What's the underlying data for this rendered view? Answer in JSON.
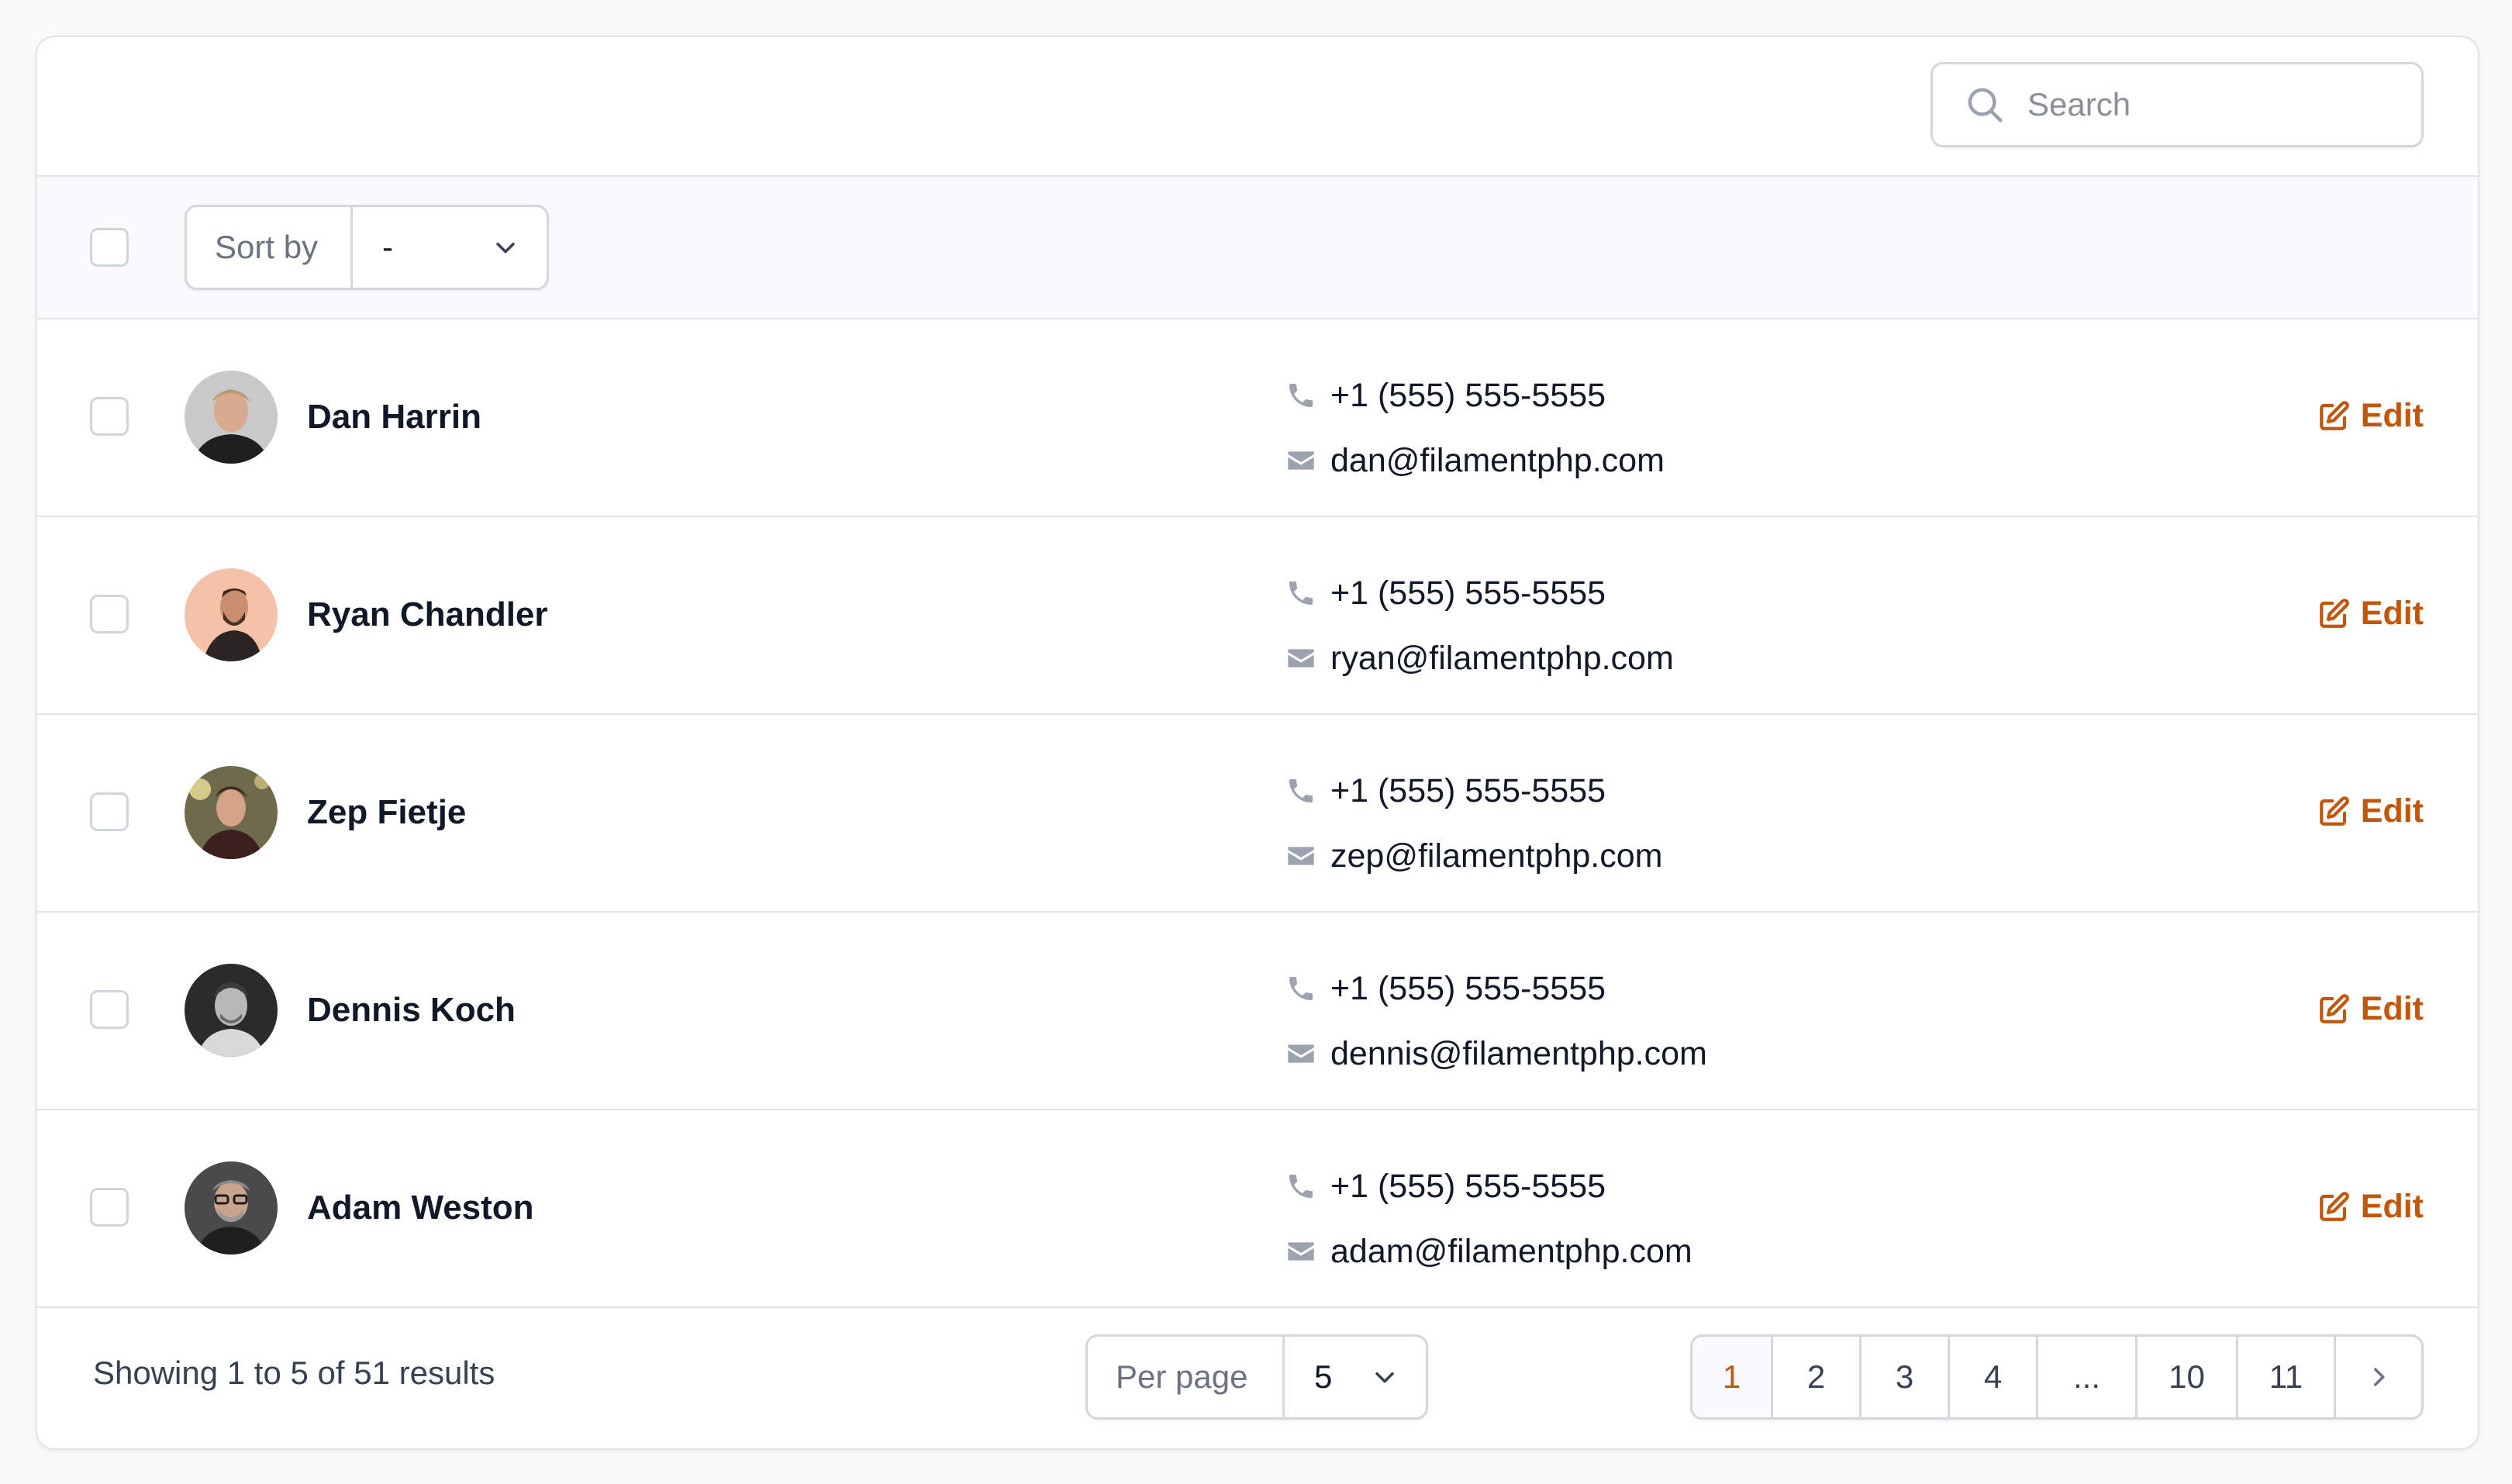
{
  "search": {
    "placeholder": "Search"
  },
  "toolbar": {
    "sort_label": "Sort by",
    "sort_value": "-"
  },
  "rows": [
    {
      "name": "Dan Harrin",
      "phone": "+1 (555) 555-5555",
      "email": "dan@filamentphp.com",
      "edit_label": "Edit"
    },
    {
      "name": "Ryan Chandler",
      "phone": "+1 (555) 555-5555",
      "email": "ryan@filamentphp.com",
      "edit_label": "Edit"
    },
    {
      "name": "Zep Fietje",
      "phone": "+1 (555) 555-5555",
      "email": "zep@filamentphp.com",
      "edit_label": "Edit"
    },
    {
      "name": "Dennis Koch",
      "phone": "+1 (555) 555-5555",
      "email": "dennis@filamentphp.com",
      "edit_label": "Edit"
    },
    {
      "name": "Adam Weston",
      "phone": "+1 (555) 555-5555",
      "email": "adam@filamentphp.com",
      "edit_label": "Edit"
    }
  ],
  "footer": {
    "showing": "Showing 1 to 5 of 51 results",
    "per_page_label": "Per page",
    "per_page_value": "5",
    "pages": [
      "1",
      "2",
      "3",
      "4",
      "...",
      "10",
      "11"
    ],
    "active_page": "1"
  },
  "colors": {
    "accent": "#c2570c",
    "border": "#e3e4e8",
    "muted_icon": "#9ca3af"
  },
  "icons": {
    "search": "search-icon",
    "phone": "phone-icon",
    "email": "envelope-icon",
    "edit": "pencil-square-icon",
    "next": "chevron-right-icon"
  }
}
